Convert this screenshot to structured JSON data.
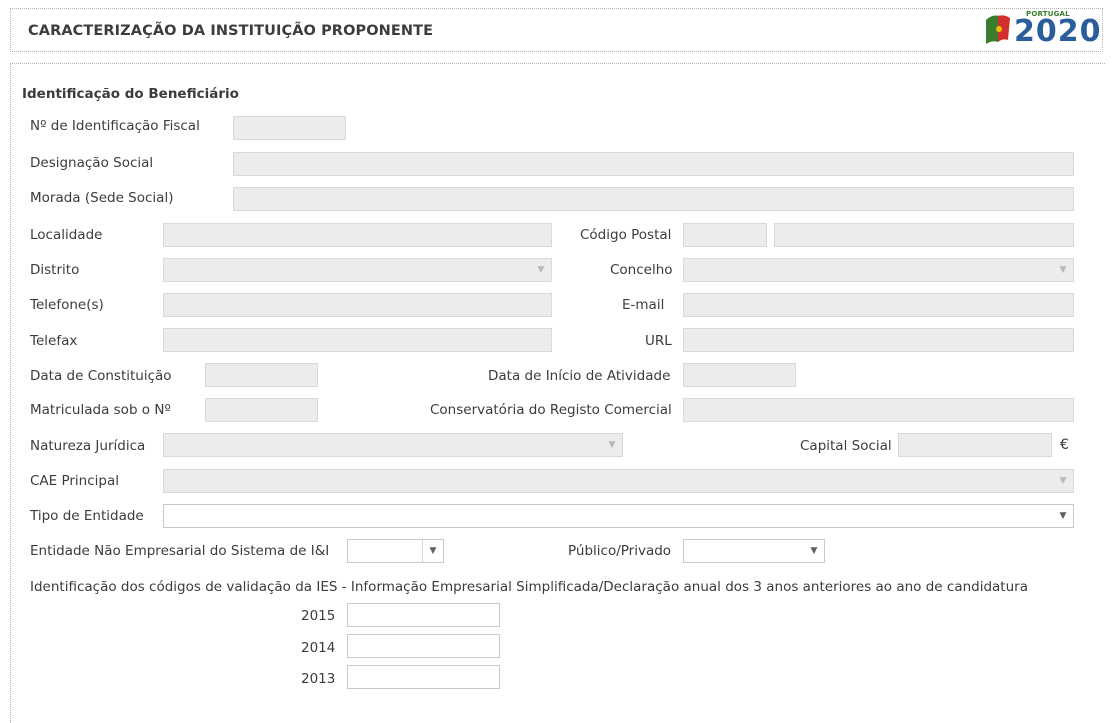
{
  "header": {
    "title": "CARACTERIZAÇÃO DA INSTITUIÇÃO PROPONENTE"
  },
  "logo": {
    "country": "PORTUGAL",
    "year": "2020",
    "colors": {
      "green": "#3a7d2c",
      "red": "#d32f2f",
      "yellow": "#f2c200",
      "blue": "#2a5d9c"
    }
  },
  "section": {
    "title": "Identificação do Beneficiário"
  },
  "labels": {
    "nif": "Nº de Identificação Fiscal",
    "designacao": "Designação Social",
    "morada": "Morada (Sede Social)",
    "localidade": "Localidade",
    "codigo_postal": "Código Postal",
    "distrito": "Distrito",
    "concelho": "Concelho",
    "telefone": "Telefone(s)",
    "email": "E-mail",
    "telefax": "Telefax",
    "url": "URL",
    "data_constituicao": "Data de Constituição",
    "data_inicio": "Data de Início de Atividade",
    "matriculada": "Matriculada sob o Nº",
    "conservatoria": "Conservatória do Registo Comercial",
    "natureza": "Natureza Jurídica",
    "capital": "Capital Social",
    "currency": "€",
    "cae": "CAE Principal",
    "tipo": "Tipo de Entidade",
    "entidade_nao_emp": "Entidade Não Empresarial do Sistema de I&I",
    "publico_privado": "Público/Privado",
    "ies": "Identificação dos códigos de validação da IES - Informação Empresarial Simplificada/Declaração anual dos 3 anos anteriores ao ano de candidatura"
  },
  "ies_years": [
    "2015",
    "2014",
    "2013"
  ],
  "values": {
    "nif": "",
    "designacao": "",
    "morada": "",
    "localidade": "",
    "codigo_postal_1": "",
    "codigo_postal_2": "",
    "distrito": "",
    "concelho": "",
    "telefone": "",
    "email": "",
    "telefax": "",
    "url": "",
    "data_constituicao": "",
    "data_inicio": "",
    "matriculada": "",
    "conservatoria": "",
    "natureza": "",
    "capital": "",
    "cae": "",
    "tipo": "",
    "entidade_nao_emp": "",
    "publico_privado": "",
    "ies_2015": "",
    "ies_2014": "",
    "ies_2013": ""
  }
}
